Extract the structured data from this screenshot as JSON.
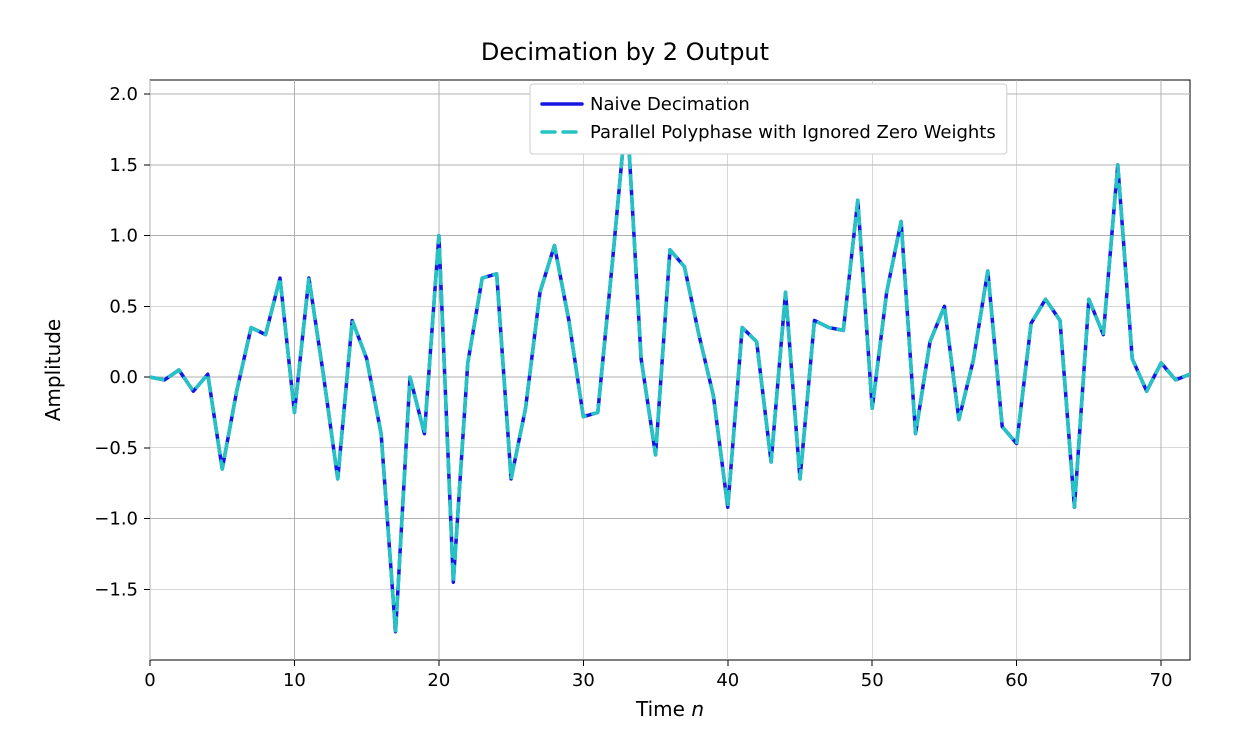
{
  "chart_data": {
    "type": "line",
    "title": "Decimation by 2 Output",
    "xlabel": "Time n",
    "ylabel": "Amplitude",
    "xlim": [
      0,
      72
    ],
    "ylim": [
      -2.0,
      2.1
    ],
    "xticks": [
      0,
      10,
      20,
      30,
      40,
      50,
      60,
      70
    ],
    "yticks": [
      -1.5,
      -1.0,
      -0.5,
      0.0,
      0.5,
      1.0,
      1.5,
      2.0
    ],
    "xtick_labels": [
      "0",
      "10",
      "20",
      "30",
      "40",
      "50",
      "60",
      "70"
    ],
    "ytick_labels": [
      "−1.5",
      "−1.0",
      "−0.5",
      "0.0",
      "0.5",
      "1.0",
      "1.5",
      "2.0"
    ],
    "grid": true,
    "legend_position": "upper-center-right",
    "series": [
      {
        "name": "Naive Decimation",
        "color": "#1515e6",
        "style": "solid",
        "x": [
          0,
          1,
          2,
          3,
          4,
          5,
          6,
          7,
          8,
          9,
          10,
          11,
          12,
          13,
          14,
          15,
          16,
          17,
          18,
          19,
          20,
          21,
          22,
          23,
          24,
          25,
          26,
          27,
          28,
          29,
          30,
          31,
          32,
          33,
          34,
          35,
          36,
          37,
          38,
          39,
          40,
          41,
          42,
          43,
          44,
          45,
          46,
          47,
          48,
          49,
          50,
          51,
          52,
          53,
          54,
          55,
          56,
          57,
          58,
          59,
          60,
          61,
          62,
          63,
          64,
          65,
          66,
          67,
          68,
          69,
          70,
          71,
          72
        ],
        "y": [
          0.0,
          -0.02,
          0.05,
          -0.1,
          0.02,
          -0.65,
          -0.1,
          0.35,
          0.3,
          0.7,
          -0.25,
          0.7,
          0.02,
          -0.72,
          0.4,
          0.13,
          -0.4,
          -1.8,
          0.0,
          -0.4,
          1.0,
          -1.45,
          0.1,
          0.7,
          0.73,
          -0.72,
          -0.22,
          0.6,
          0.93,
          0.4,
          -0.28,
          -0.25,
          0.8,
          1.9,
          0.13,
          -0.55,
          0.9,
          0.78,
          0.3,
          -0.13,
          -0.92,
          0.35,
          0.25,
          -0.6,
          0.6,
          -0.72,
          0.4,
          0.35,
          0.33,
          1.25,
          -0.22,
          0.6,
          1.1,
          -0.4,
          0.25,
          0.5,
          -0.3,
          0.12,
          0.75,
          -0.35,
          -0.47,
          0.38,
          0.55,
          0.4,
          -0.92,
          0.55,
          0.3,
          1.5,
          0.13,
          -0.1,
          0.1,
          -0.02,
          0.02
        ]
      },
      {
        "name": "Parallel Polyphase with Ignored Zero Weights",
        "color": "#24c4c4",
        "style": "dashed",
        "x": [
          0,
          1,
          2,
          3,
          4,
          5,
          6,
          7,
          8,
          9,
          10,
          11,
          12,
          13,
          14,
          15,
          16,
          17,
          18,
          19,
          20,
          21,
          22,
          23,
          24,
          25,
          26,
          27,
          28,
          29,
          30,
          31,
          32,
          33,
          34,
          35,
          36,
          37,
          38,
          39,
          40,
          41,
          42,
          43,
          44,
          45,
          46,
          47,
          48,
          49,
          50,
          51,
          52,
          53,
          54,
          55,
          56,
          57,
          58,
          59,
          60,
          61,
          62,
          63,
          64,
          65,
          66,
          67,
          68,
          69,
          70,
          71,
          72
        ],
        "y": [
          0.0,
          -0.02,
          0.05,
          -0.1,
          0.02,
          -0.65,
          -0.1,
          0.35,
          0.3,
          0.7,
          -0.25,
          0.7,
          0.02,
          -0.72,
          0.4,
          0.13,
          -0.4,
          -1.8,
          0.0,
          -0.4,
          1.0,
          -1.45,
          0.1,
          0.7,
          0.73,
          -0.72,
          -0.22,
          0.6,
          0.93,
          0.4,
          -0.28,
          -0.25,
          0.8,
          1.9,
          0.13,
          -0.55,
          0.9,
          0.78,
          0.3,
          -0.13,
          -0.92,
          0.35,
          0.25,
          -0.6,
          0.6,
          -0.72,
          0.4,
          0.35,
          0.33,
          1.25,
          -0.22,
          0.6,
          1.1,
          -0.4,
          0.25,
          0.5,
          -0.3,
          0.12,
          0.75,
          -0.35,
          -0.47,
          0.38,
          0.55,
          0.4,
          -0.92,
          0.55,
          0.3,
          1.5,
          0.13,
          -0.1,
          0.1,
          -0.02,
          0.02
        ]
      }
    ]
  }
}
